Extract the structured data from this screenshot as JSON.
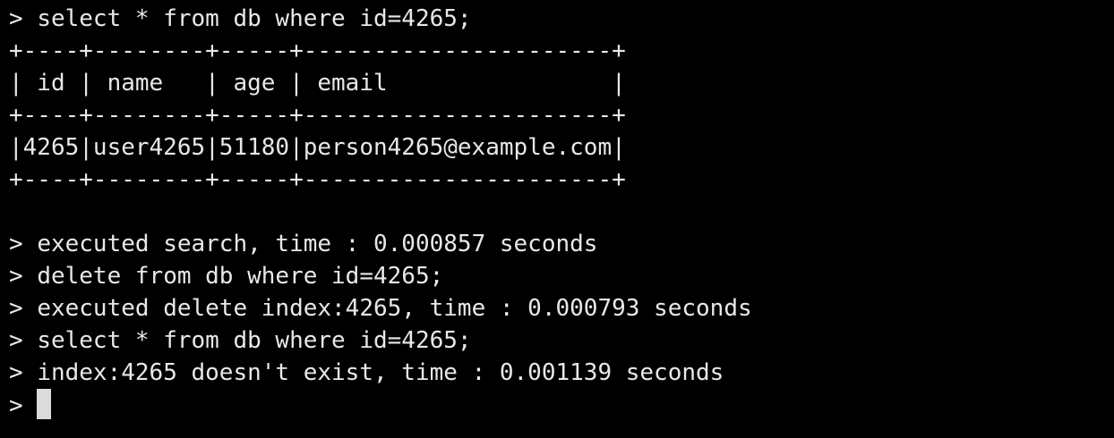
{
  "terminal": {
    "prompt": "> ",
    "lines_before_table": [
      "select * from db where id=4265;"
    ],
    "table": {
      "border": "+----+--------+-----+----------------------+",
      "header": "| id | name   | age | email                |",
      "header_sep": "+----+--------+-----+----------------------+",
      "rows": [
        "|4265|user4265|51180|person4265@example.com|"
      ],
      "footer": "+----+--------+-----+----------------------+"
    },
    "lines_after_table": [
      "executed search, time : 0.000857 seconds",
      "delete from db where id=4265;",
      "executed delete index:4265, time : 0.000793 seconds",
      "select * from db where id=4265;",
      "index:4265 doesn't exist, time : 0.001139 seconds"
    ],
    "current_input": "",
    "colors": {
      "background": "#000000",
      "text": "#e8e8e8",
      "cursor": "#dcdcdc"
    }
  }
}
